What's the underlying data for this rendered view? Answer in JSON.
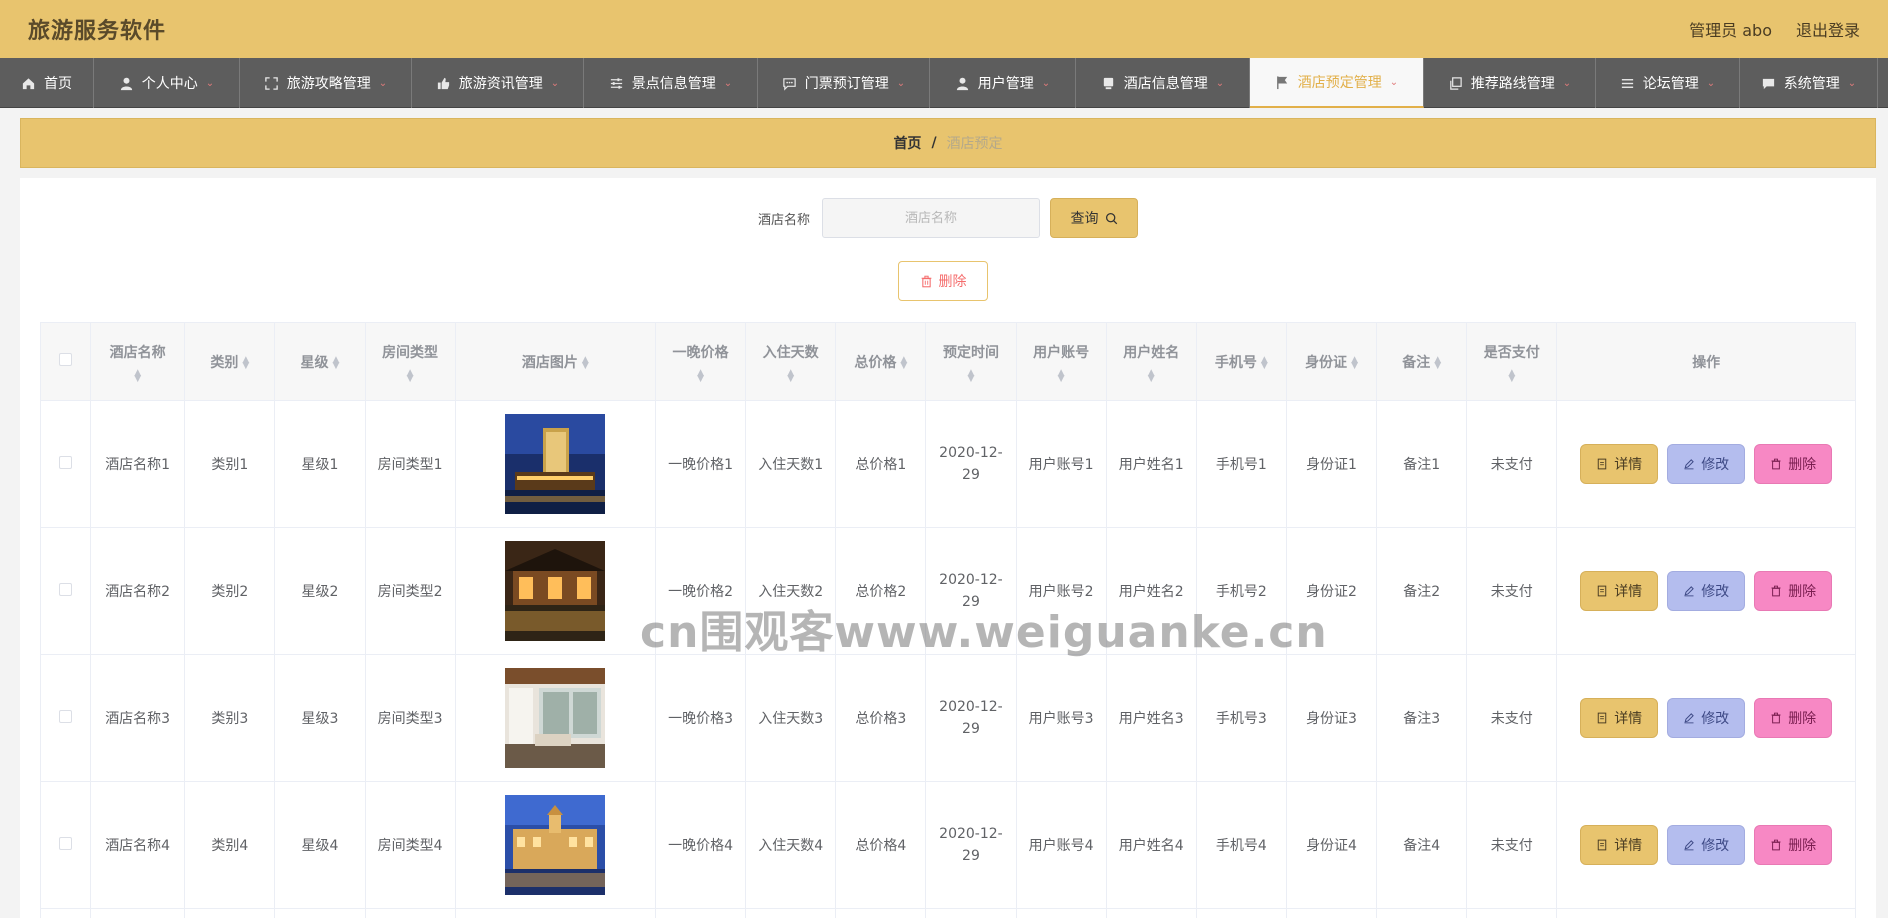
{
  "header": {
    "app_title": "旅游服务软件",
    "admin_label": "管理员 abo",
    "logout_label": "退出登录"
  },
  "nav": [
    {
      "label": "首页",
      "icon": "home-icon",
      "has_menu": false
    },
    {
      "label": "个人中心",
      "icon": "user-icon",
      "has_menu": true
    },
    {
      "label": "旅游攻略管理",
      "icon": "fullscreen-icon",
      "has_menu": true
    },
    {
      "label": "旅游资讯管理",
      "icon": "thumb-icon",
      "has_menu": true
    },
    {
      "label": "景点信息管理",
      "icon": "sliders-icon",
      "has_menu": true
    },
    {
      "label": "门票预订管理",
      "icon": "chat-icon",
      "has_menu": true
    },
    {
      "label": "用户管理",
      "icon": "user-icon",
      "has_menu": true
    },
    {
      "label": "酒店信息管理",
      "icon": "box-icon",
      "has_menu": true
    },
    {
      "label": "酒店预定管理",
      "icon": "flag-icon",
      "has_menu": true,
      "active": true
    },
    {
      "label": "推荐路线管理",
      "icon": "copy-icon",
      "has_menu": true
    },
    {
      "label": "论坛管理",
      "icon": "list-icon",
      "has_menu": true
    },
    {
      "label": "系统管理",
      "icon": "message-icon",
      "has_menu": true
    }
  ],
  "breadcrumb": {
    "home": "首页",
    "separator": "/",
    "current": "酒店预定"
  },
  "search": {
    "label": "酒店名称",
    "placeholder": "酒店名称",
    "query_label": "查询"
  },
  "toolbar": {
    "delete_label": "删除"
  },
  "table": {
    "columns": [
      "酒店名称",
      "类别",
      "星级",
      "房间类型",
      "酒店图片",
      "一晚价格",
      "入住天数",
      "总价格",
      "预定时间",
      "用户账号",
      "用户姓名",
      "手机号",
      "身份证",
      "备注",
      "是否支付",
      "操作"
    ],
    "rows": [
      {
        "name": "酒店名称1",
        "category": "类别1",
        "star": "星级1",
        "room_type": "房间类型1",
        "image": "hotel-tower-night",
        "night_price": "一晚价格1",
        "days": "入住天数1",
        "total": "总价格1",
        "booking_time": "2020-12-29",
        "account": "用户账号1",
        "user_name": "用户姓名1",
        "phone": "手机号1",
        "id_card": "身份证1",
        "remark": "备注1",
        "paid": "未支付"
      },
      {
        "name": "酒店名称2",
        "category": "类别2",
        "star": "星级2",
        "room_type": "房间类型2",
        "image": "hotel-courtyard",
        "night_price": "一晚价格2",
        "days": "入住天数2",
        "total": "总价格2",
        "booking_time": "2020-12-29",
        "account": "用户账号2",
        "user_name": "用户姓名2",
        "phone": "手机号2",
        "id_card": "身份证2",
        "remark": "备注2",
        "paid": "未支付"
      },
      {
        "name": "酒店名称3",
        "category": "类别3",
        "star": "星级3",
        "room_type": "房间类型3",
        "image": "hotel-room-interior",
        "night_price": "一晚价格3",
        "days": "入住天数3",
        "total": "总价格3",
        "booking_time": "2020-12-29",
        "account": "用户账号3",
        "user_name": "用户姓名3",
        "phone": "手机号3",
        "id_card": "身份证3",
        "remark": "备注3",
        "paid": "未支付"
      },
      {
        "name": "酒店名称4",
        "category": "类别4",
        "star": "星级4",
        "room_type": "房间类型4",
        "image": "hotel-palace-dusk",
        "night_price": "一晚价格4",
        "days": "入住天数4",
        "total": "总价格4",
        "booking_time": "2020-12-29",
        "account": "用户账号4",
        "user_name": "用户姓名4",
        "phone": "手机号4",
        "id_card": "身份证4",
        "remark": "备注4",
        "paid": "未支付"
      }
    ],
    "actions": {
      "detail": "详情",
      "edit": "修改",
      "delete": "删除"
    }
  },
  "watermark": "cn围观客www.weiguanke.cn",
  "colors": {
    "accent": "#e8c46e",
    "nav_bg": "#5d5d5d",
    "edit_btn": "#b4bdee",
    "delete_btn": "#f788c4",
    "danger_text": "#f56c6c"
  }
}
